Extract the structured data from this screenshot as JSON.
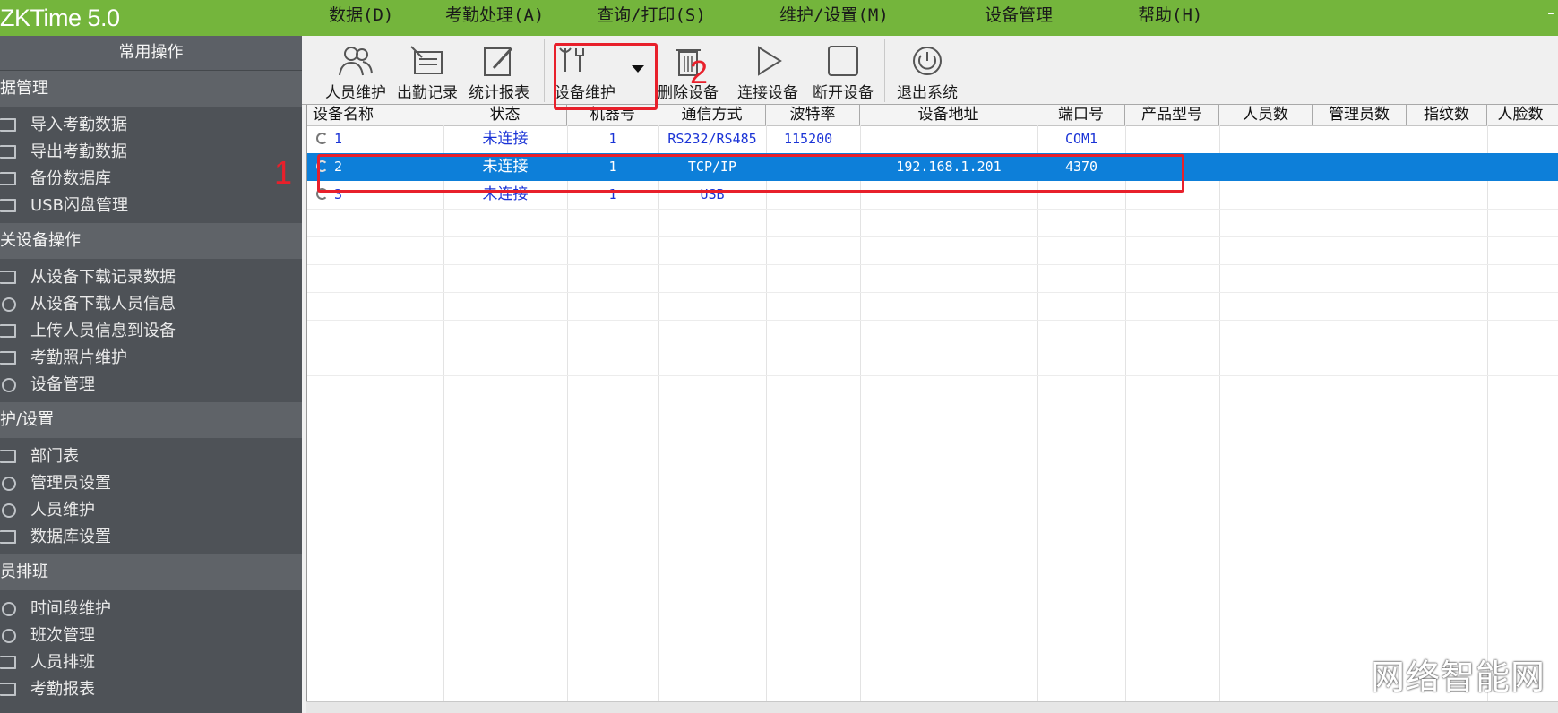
{
  "app": {
    "title": "ZKTime 5.0",
    "minimize_glyph": "-"
  },
  "menu": [
    {
      "label": "数据(D)"
    },
    {
      "label": "考勤处理(A)"
    },
    {
      "label": "查询/打印(S)"
    },
    {
      "label": "维护/设置(M)"
    },
    {
      "label": "设备管理"
    },
    {
      "label": "帮助(H)"
    }
  ],
  "sidebar": {
    "header": "常用操作",
    "sections": [
      {
        "title": "数据管理",
        "items": [
          "导入考勤数据",
          "导出考勤数据",
          "备份数据库",
          "USB闪盘管理"
        ]
      },
      {
        "title": "相关设备操作",
        "items": [
          "从设备下载记录数据",
          "从设备下载人员信息",
          "上传人员信息到设备",
          "考勤照片维护",
          "设备管理"
        ]
      },
      {
        "title": "维护/设置",
        "items": [
          "部门表",
          "管理员设置",
          "人员维护",
          "数据库设置"
        ]
      },
      {
        "title": "人员排班",
        "items": [
          "时间段维护",
          "班次管理",
          "人员排班",
          "考勤报表"
        ]
      }
    ]
  },
  "toolbar": {
    "person_maint": "人员维护",
    "attendance_records": "出勤记录",
    "stat_report": "统计报表",
    "device_maint": "设备维护",
    "delete_device": "删除设备",
    "connect_device": "连接设备",
    "disconnect_device": "断开设备",
    "exit_system": "退出系统"
  },
  "table": {
    "columns": [
      "设备名称",
      "状态",
      "机器号",
      "通信方式",
      "波特率",
      "设备地址",
      "端口号",
      "产品型号",
      "人员数",
      "管理员数",
      "指纹数",
      "人脸数"
    ],
    "rows": [
      {
        "name": "1",
        "status": "未连接",
        "machine_no": "1",
        "comm": "RS232/RS485",
        "baud": "115200",
        "address": "",
        "port": "COM1"
      },
      {
        "name": "2",
        "status": "未连接",
        "machine_no": "1",
        "comm": "TCP/IP",
        "baud": "",
        "address": "192.168.1.201",
        "port": "4370"
      },
      {
        "name": "3",
        "status": "未连接",
        "machine_no": "1",
        "comm": "USB",
        "baud": "",
        "address": "",
        "port": ""
      }
    ]
  },
  "annotations": {
    "label_1": "1",
    "label_2": "2"
  },
  "watermark": "网络智能网",
  "colors": {
    "titlebar": "#74b53c",
    "sidebar": "#4e5257",
    "selection": "#0d7fd9",
    "annotation": "#e8202b"
  }
}
